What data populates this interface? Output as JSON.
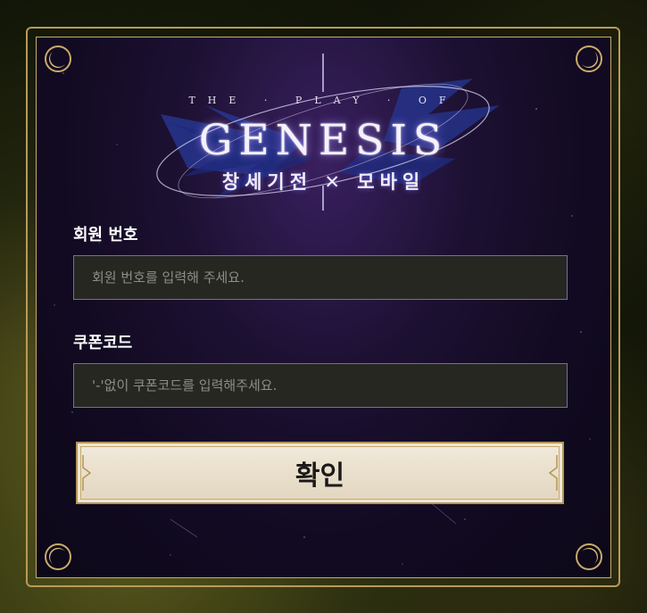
{
  "logo": {
    "subtitle": "THE · PLAY · OF",
    "title": "GENESIS",
    "korean": "창세기전 ✕ 모바일"
  },
  "form": {
    "member_label": "회원 번호",
    "member_placeholder": "회원 번호를 입력해 주세요.",
    "coupon_label": "쿠폰코드",
    "coupon_placeholder": "'-'없이 쿠폰코드를 입력해주세요.",
    "confirm_label": "확인"
  },
  "colors": {
    "frame_gold": "#c9ab6a",
    "panel_purple": "#1d1133",
    "input_border": "#6b6fb8",
    "button_bg": "#ece2cf"
  },
  "icons": [
    "crescent-ornament-icon",
    "crossed-swords-icon"
  ]
}
